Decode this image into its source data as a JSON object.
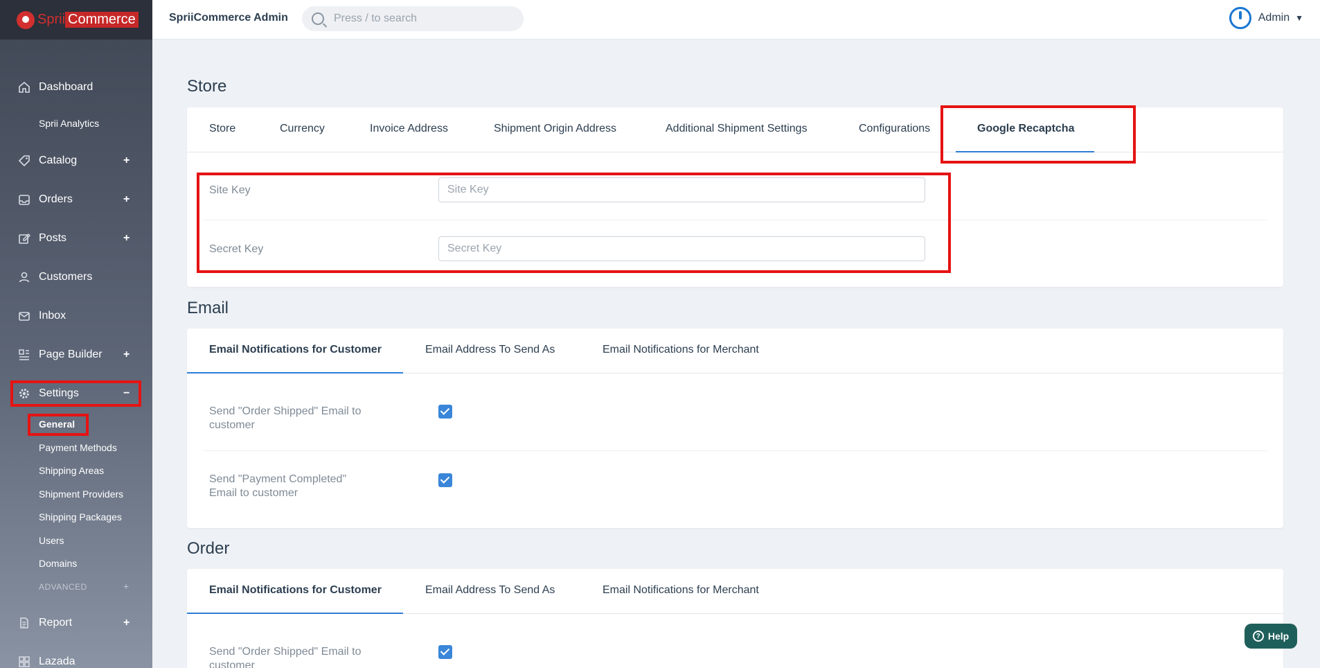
{
  "logo": {
    "sprii": "Sprii",
    "commerce": "Commerce"
  },
  "topbar": {
    "title": "SpriiCommerce Admin",
    "search_placeholder": "Press / to search",
    "user": "Admin"
  },
  "sidebar": {
    "items": [
      {
        "label": "Dashboard",
        "icon": "home-icon"
      },
      {
        "label": "Sprii Analytics"
      },
      {
        "label": "Catalog",
        "icon": "tag-icon",
        "expand": "+"
      },
      {
        "label": "Orders",
        "icon": "inbox-tray-icon",
        "expand": "+"
      },
      {
        "label": "Posts",
        "icon": "edit-icon",
        "expand": "+"
      },
      {
        "label": "Customers",
        "icon": "user-icon"
      },
      {
        "label": "Inbox",
        "icon": "mail-icon"
      },
      {
        "label": "Page Builder",
        "icon": "layout-icon",
        "expand": "+"
      },
      {
        "label": "Settings",
        "icon": "gear-icon",
        "expand": "−"
      },
      {
        "label": "Report",
        "icon": "document-icon",
        "expand": "+"
      },
      {
        "label": "Lazada",
        "icon": "grid-icon"
      }
    ],
    "settings_sub": [
      "General",
      "Payment Methods",
      "Shipping Areas",
      "Shipment Providers",
      "Shipping Packages",
      "Users",
      "Domains"
    ],
    "advanced_label": "ADVANCED",
    "advanced_expand": "+"
  },
  "store": {
    "title": "Store",
    "tabs": [
      "Store",
      "Currency",
      "Invoice Address",
      "Shipment Origin Address",
      "Additional Shipment Settings",
      "Configurations",
      "Google Recaptcha"
    ],
    "active_tab": "Google Recaptcha",
    "fields": [
      {
        "label": "Site Key",
        "placeholder": "Site Key",
        "value": ""
      },
      {
        "label": "Secret Key",
        "placeholder": "Secret Key",
        "value": ""
      }
    ]
  },
  "email": {
    "title": "Email",
    "tabs": [
      "Email Notifications for Customer",
      "Email Address To Send As",
      "Email Notifications for Merchant"
    ],
    "active_tab": "Email Notifications for Customer",
    "options": [
      {
        "label_line1": "Send \"Order Shipped\" Email to",
        "label_line2": "customer",
        "checked": true
      },
      {
        "label_line1": "Send \"Payment Completed\"",
        "label_line2": "Email to customer",
        "checked": true
      }
    ]
  },
  "order": {
    "title": "Order",
    "tabs": [
      "Email Notifications for Customer",
      "Email Address To Send As",
      "Email Notifications for Merchant"
    ],
    "active_tab": "Email Notifications for Customer",
    "options": [
      {
        "label_line1": "Send \"Order Shipped\" Email to",
        "label_line2": "customer",
        "checked": true
      }
    ]
  },
  "help": {
    "label": "Help",
    "icon": "question-icon"
  },
  "colors": {
    "accent": "#2d7ed6",
    "highlight": "#e51313",
    "help": "#1f5f5b",
    "check": "#3a86d9"
  }
}
